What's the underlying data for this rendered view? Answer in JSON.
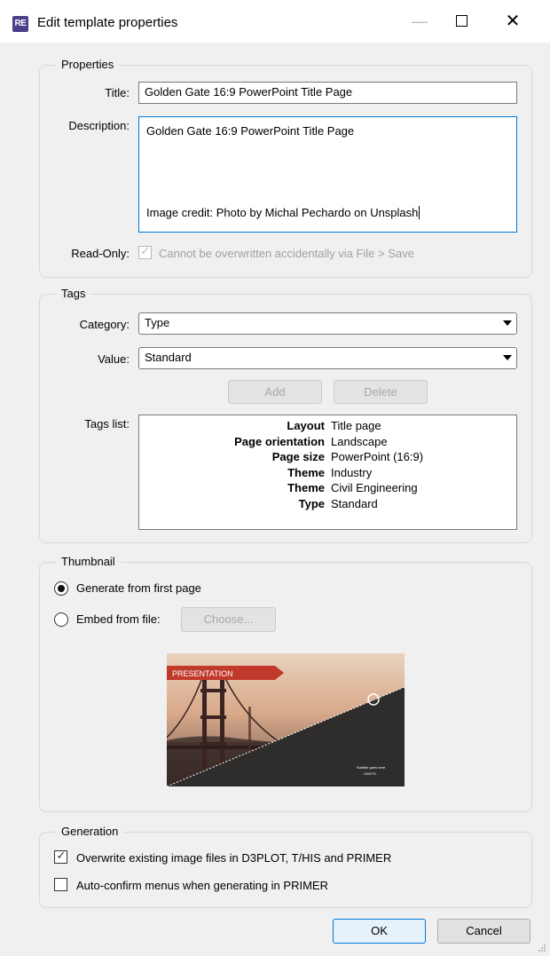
{
  "window": {
    "app_icon_text": "RE",
    "title": "Edit template properties",
    "minimize_icon": "minimize-icon",
    "maximize_icon": "maximize-icon",
    "close_icon": "close-icon"
  },
  "properties": {
    "legend": "Properties",
    "title_label": "Title:",
    "title_value": "Golden Gate 16:9 PowerPoint Title Page",
    "description_label": "Description:",
    "description_line1": "Golden Gate 16:9 PowerPoint Title Page",
    "description_line2": "Image credit: Photo by Michal Pechardo on Unsplash",
    "readonly_label": "Read-Only:",
    "readonly_text": "Cannot be overwritten accidentally via File > Save",
    "readonly_checked": true
  },
  "tags": {
    "legend": "Tags",
    "category_label": "Category:",
    "category_value": "Type",
    "value_label": "Value:",
    "value_value": "Standard",
    "add_label": "Add",
    "delete_label": "Delete",
    "list_label": "Tags list:",
    "list": [
      {
        "key": "Layout",
        "value": "Title page"
      },
      {
        "key": "Page orientation",
        "value": "Landscape"
      },
      {
        "key": "Page size",
        "value": "PowerPoint (16:9)"
      },
      {
        "key": "Theme",
        "value": "Industry"
      },
      {
        "key": "Theme",
        "value": "Civil Engineering"
      },
      {
        "key": "Type",
        "value": "Standard"
      }
    ]
  },
  "thumbnail": {
    "legend": "Thumbnail",
    "generate_label": "Generate from first page",
    "embed_label": "Embed from file:",
    "choose_label": "Choose...",
    "selected": "generate",
    "preview_banner": "PRESENTATION",
    "preview_subtitle": "Subtitle goes here",
    "preview_logo": "OASYS"
  },
  "generation": {
    "legend": "Generation",
    "overwrite_label": "Overwrite existing image files in D3PLOT, T/HIS and PRIMER",
    "overwrite_checked": true,
    "autoconfirm_label": "Auto-confirm menus when generating in PRIMER",
    "autoconfirm_checked": false
  },
  "footer": {
    "ok_label": "OK",
    "cancel_label": "Cancel"
  },
  "colors": {
    "accent": "#0078d7",
    "app_icon_bg": "#4c3e8c",
    "banner": "#c0392b"
  }
}
